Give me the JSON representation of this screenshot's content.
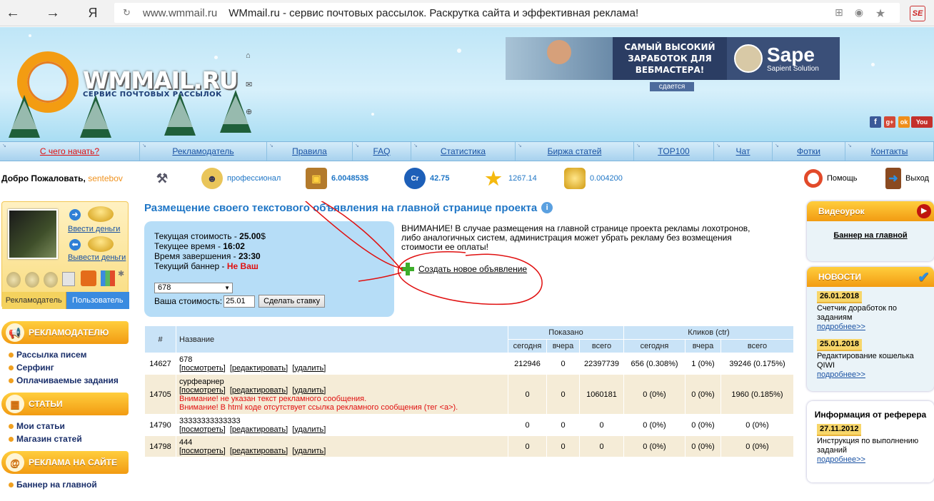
{
  "browser": {
    "back": "←",
    "forward": "→",
    "yandex": "Я",
    "url": "www.wmmail.ru",
    "title": "WMmail.ru - сервис почтовых рассылок. Раскрутка сайта и эффективная реклама!",
    "ext": "SE"
  },
  "header": {
    "logo_text": "WMMAIL.RU",
    "logo_sub": "СЕРВИС ПОЧТОВЫХ РАССЫЛОК",
    "banner_text": "САМЫЙ ВЫСОКИЙ ЗАРАБОТОК ДЛЯ ВЕБМАСТЕРА!",
    "banner_brand": "Sape",
    "banner_brand_sub": "Sapient Solution",
    "banner_rent": "сдается",
    "social": [
      "f",
      "g+",
      "ok",
      "You"
    ]
  },
  "menu": [
    "С чего начать?",
    "Рекламодатель",
    "Правила",
    "FAQ",
    "Статистика",
    "Биржа статей",
    "TOP100",
    "Чат",
    "Фотки",
    "Контакты"
  ],
  "status": {
    "welcome": "Добро Пожаловать,",
    "username": "sentebov",
    "level": "профессионал",
    "balance": "6.004853$",
    "credits": "42.75",
    "rating": "1267.14",
    "coins": "0.004200",
    "help": "Помощь",
    "logout": "Выход"
  },
  "left": {
    "deposit": "Ввести деньги",
    "withdraw": "Вывести деньги",
    "tab_advertiser": "Рекламодатель",
    "tab_user": "Пользователь",
    "sections": [
      {
        "title": "РЕКЛАМОДАТЕЛЮ",
        "items": [
          "Рассылка писем",
          "Серфинг",
          "Оплачиваемые задания"
        ]
      },
      {
        "title": "СТАТЬИ",
        "items": [
          "Мои статьи",
          "Магазин статей"
        ]
      },
      {
        "title": "РЕКЛАМА НА САЙТЕ",
        "items": [
          "Баннер на главной"
        ]
      }
    ]
  },
  "main": {
    "title": "Размещение своего текстового объявления на главной странице проекта",
    "cur_cost_label": "Текущая стоимость - ",
    "cur_cost": "25.00",
    "cur_cost_unit": "$",
    "cur_time_label": "Текущее время - ",
    "cur_time": "16:02",
    "end_time_label": "Время завершения - ",
    "end_time": "23:30",
    "cur_banner_label": "Текущий баннер - ",
    "cur_banner": "Не Ваш",
    "select_value": "678",
    "your_cost_label": "Ваша стоимость:",
    "your_cost": "25.01",
    "bid_button": "Сделать ставку",
    "warning": "ВНИМАНИЕ! В случае размещения на главной странице проекта рекламы лохотронов, либо аналогичных систем, администрация может убрать рекламу без возмещения стоимости ее оплаты!",
    "create_new": "Создать новое объявление"
  },
  "table": {
    "h_num": "#",
    "h_name": "Название",
    "h_shown": "Показано",
    "h_clicks": "Кликов (ctr)",
    "h_today": "сегодня",
    "h_yesterday": "вчера",
    "h_total": "всего",
    "view": "[посмотреть]",
    "edit": "[редактировать]",
    "delete": "[удалить]",
    "rows": [
      {
        "id": "14627",
        "name": "678",
        "errors": [],
        "s_today": "212946",
        "s_yest": "0",
        "s_total": "22397739",
        "c_today": "656 (0.308%)",
        "c_yest": "1 (0%)",
        "c_total": "39246 (0.175%)"
      },
      {
        "id": "14705",
        "name": "сурфеарнер",
        "errors": [
          "Внимание! не указан текст рекламного сообщения.",
          "Внимание! В html коде отсутствует ссылка рекламного сообщения (тег <a>)."
        ],
        "s_today": "0",
        "s_yest": "0",
        "s_total": "1060181",
        "c_today": "0 (0%)",
        "c_yest": "0 (0%)",
        "c_total": "1960 (0.185%)"
      },
      {
        "id": "14790",
        "name": "33333333333333",
        "errors": [],
        "s_today": "0",
        "s_yest": "0",
        "s_total": "0",
        "c_today": "0 (0%)",
        "c_yest": "0 (0%)",
        "c_total": "0 (0%)"
      },
      {
        "id": "14798",
        "name": "444",
        "errors": [],
        "s_today": "0",
        "s_yest": "0",
        "s_total": "0",
        "c_today": "0 (0%)",
        "c_yest": "0 (0%)",
        "c_total": "0 (0%)"
      }
    ]
  },
  "right": {
    "video_title": "Видеоурок",
    "video_link": "Баннер на главной",
    "news_title": "НОВОСТИ",
    "news": [
      {
        "date": "26.01.2018",
        "text": "Счетчик доработок по заданиям",
        "more": "подробнее>>"
      },
      {
        "date": "25.01.2018",
        "text": "Редактирование кошелька QIWI",
        "more": "подробнее>>"
      }
    ],
    "ref_title": "Информация от реферера",
    "ref": {
      "date": "27.11.2012",
      "text": "Инструкция по выполнению заданий",
      "more": "подробнее>>"
    }
  }
}
